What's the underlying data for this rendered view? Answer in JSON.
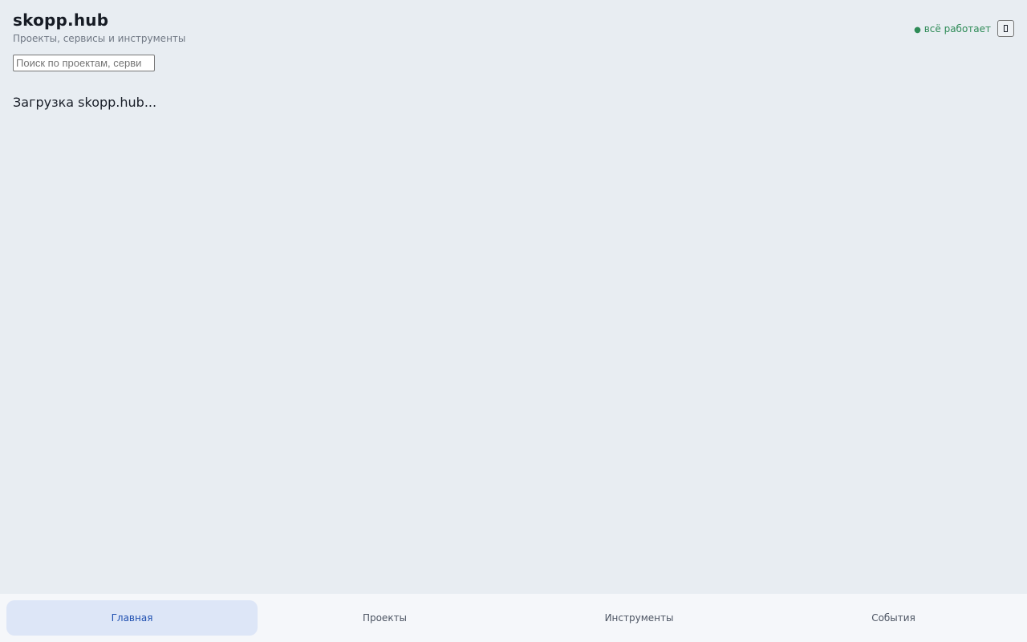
{
  "header": {
    "title": "skopp.hub",
    "subtitle": "Проекты, сервисы и инструменты"
  },
  "search": {
    "placeholder": "Поиск по проектам, серви",
    "value": ""
  },
  "status": {
    "dot": "●",
    "text": "всё работает",
    "color": "#2e8b57"
  },
  "theme_toggle": {
    "icon": "theme-toggle-icon"
  },
  "main": {
    "loading_text": "Загрузка skopp.hub..."
  },
  "bottom_nav": {
    "tabs": [
      {
        "label": "Главная",
        "active": true
      },
      {
        "label": "Проекты",
        "active": false
      },
      {
        "label": "Инструменты",
        "active": false
      },
      {
        "label": "События",
        "active": false
      }
    ]
  },
  "colors": {
    "background": "#e8edf2",
    "nav_background": "#f5f7fa",
    "active_tab_background": "#dde6f7",
    "active_tab_text": "#1f4fb0"
  }
}
